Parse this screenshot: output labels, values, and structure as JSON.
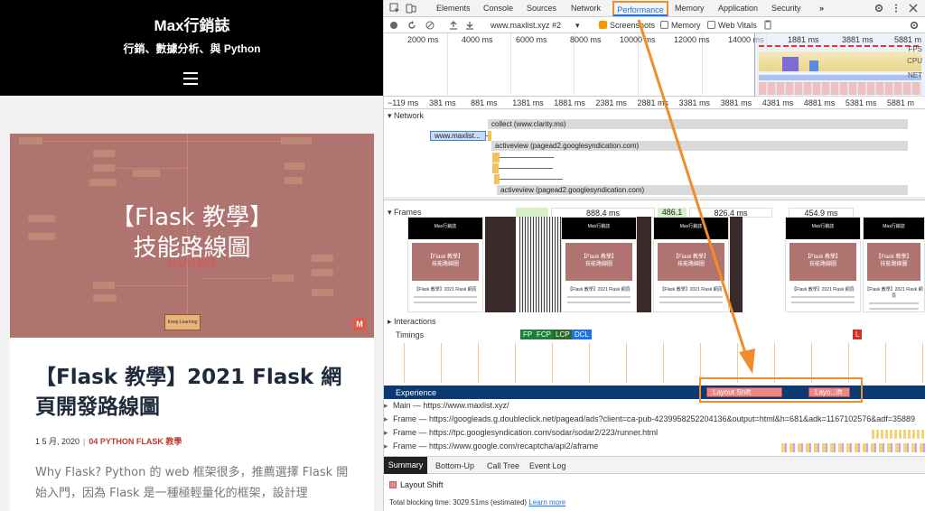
{
  "blog": {
    "site_title": "Max行銷誌",
    "site_tagline": "行銷、數據分析、與 Python",
    "featured": {
      "title_line1": "【Flask 教學】",
      "title_line2": "技能路線圖",
      "sub": "Max行銷誌",
      "keep_learning": "Keep Learning",
      "badge": "M"
    },
    "post": {
      "title": "【Flask 教學】2021 Flask 網頁開發路線圖",
      "date": "1 5 月, 2020",
      "sep": "|",
      "category": "04 PYTHON FLASK 教學",
      "excerpt": "Why Flask? Python 的 web 框架很多，推薦選擇 Flask 開始入門，因為 Flask 是一種極輕量化的框架，設計理"
    }
  },
  "devtools": {
    "tabs": [
      "Elements",
      "Console",
      "Sources",
      "Network",
      "Performance",
      "Memory",
      "Application",
      "Security"
    ],
    "more_tabs": "»",
    "active_tab": "Performance",
    "toolbar": {
      "url": "www.maxlist.xyz #2",
      "screenshots_label": "Screenshots",
      "memory_label": "Memory",
      "web_vitals_label": "Web Vitals"
    },
    "overview_ticks": [
      "2000 ms",
      "4000 ms",
      "6000 ms",
      "8000 ms",
      "10000 ms",
      "12000 ms",
      "14000 ms"
    ],
    "overview_window_ticks": [
      "1881 ms",
      "3881 ms",
      "5881 m"
    ],
    "overview_labels": [
      "FPS",
      "CPU",
      "NET"
    ],
    "ruler_ticks": [
      "−119 ms",
      "381 ms",
      "881 ms",
      "1381 ms",
      "1881 ms",
      "2381 ms",
      "2881 ms",
      "3381 ms",
      "3881 ms",
      "4381 ms",
      "4881 ms",
      "5381 ms",
      "5881 m"
    ],
    "network": {
      "label": "Network",
      "requests": [
        {
          "name": "collect (www.clarity.ms)"
        },
        {
          "name": "www.maxlist..."
        },
        {
          "name": "activeview (pagead2.googlesyndication.com)"
        },
        {
          "name": "activeview (pagead2.googlesyndication.com)"
        }
      ]
    },
    "frames": {
      "label": "Frames",
      "durations": [
        "888.4 ms",
        "486.1 ms",
        "826.4 ms",
        "454.9 ms"
      ],
      "shot_title": "Max行銷誌",
      "shot_img_line1": "【Flask 教學】",
      "shot_img_line2": "技能路線圖",
      "shot_caption": "【Flask 教學】2021 Flask 網頁"
    },
    "interactions_label": "Interactions",
    "timings": {
      "label": "Timings",
      "markers": [
        {
          "text": "FP",
          "color": "#1a7f37"
        },
        {
          "text": "FCP",
          "color": "#1a7f37"
        },
        {
          "text": "LCP",
          "color": "#2b6a2b"
        },
        {
          "text": "DCL",
          "color": "#1a73e8"
        },
        {
          "text": "L",
          "color": "#d93025"
        }
      ]
    },
    "experience": {
      "label": "Experience",
      "shifts": [
        "Layout Shift",
        "Layo...ift"
      ]
    },
    "threads": [
      "Main — https://www.maxlist.xyz/",
      "Frame — https://googleads.g.doubleclick.net/pagead/ads?client=ca-pub-4239958252204136&output=html&h=681&adk=1167102576&adf=35889",
      "Frame — https://tpc.googlesyndication.com/sodar/sodar2/223/runner.html",
      "Frame — https://www.google.com/recaptcha/api2/aframe"
    ],
    "bottom_tabs": [
      "Summary",
      "Bottom-Up",
      "Call Tree",
      "Event Log"
    ],
    "summary_item": "Layout Shift",
    "blocking_text": "Total blocking time: 3029.51ms (estimated)",
    "learn_more": "Learn more",
    "colors": {
      "accent": "#1a73e8",
      "highlight": "#f08c2a",
      "layout_shift": "#e88989",
      "experience_bg": "#0b3a73"
    }
  }
}
